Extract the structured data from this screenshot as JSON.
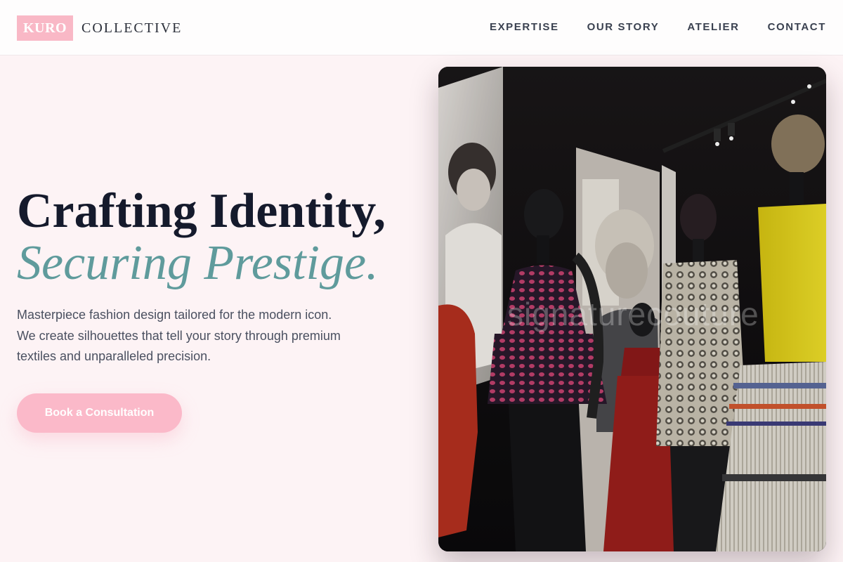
{
  "header": {
    "brand_box": "KURO",
    "brand_text": "COLLECTIVE",
    "nav": [
      "EXPERTISE",
      "OUR STORY",
      "ATELIER",
      "CONTACT"
    ]
  },
  "hero": {
    "headline": "Crafting Identity,",
    "headline_accent": "Securing Prestige.",
    "description": "Masterpiece fashion design tailored for the modern icon. We create silhouettes that tell your story through premium textiles and unparalleled precision.",
    "cta_label": "Book a Consultation",
    "watermark": "signaturecouture"
  },
  "colors": {
    "brand_pink": "#f9b8c6",
    "accent_teal": "#5f9b9c",
    "headline_dark": "#151a2c",
    "page_bg": "#fdf3f5"
  }
}
